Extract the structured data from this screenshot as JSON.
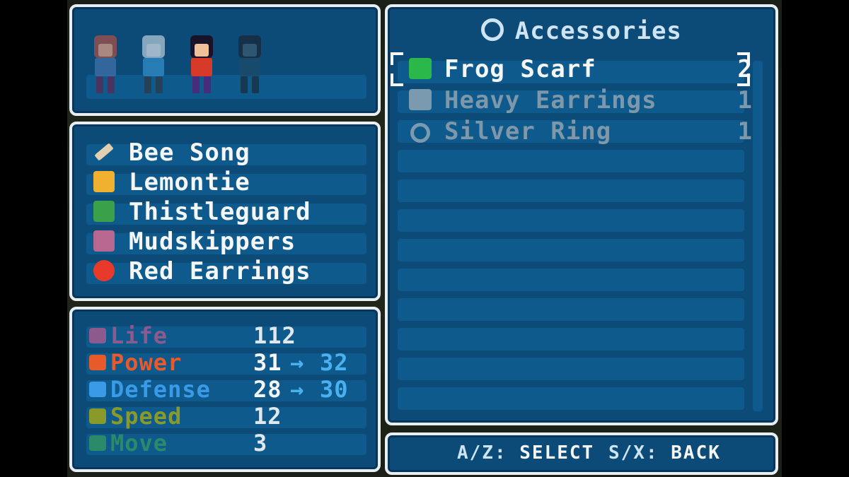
{
  "party": {
    "members": [
      {
        "name": "member-1",
        "hair": "#a0504a",
        "shirt": "#3f6fa8",
        "legs": "#5a2a55",
        "skin": "#d49a84",
        "dim": true
      },
      {
        "name": "member-2",
        "hair": "#a8c0d0",
        "shirt": "#2f8ac8",
        "legs": "#2a3a4a",
        "skin": "#c8d8e0",
        "dim": true
      },
      {
        "name": "member-3",
        "hair": "#18122a",
        "shirt": "#d83a2a",
        "legs": "#4a2a7a",
        "skin": "#f0c098",
        "dim": false
      },
      {
        "name": "member-4",
        "hair": "#1a2a3a",
        "shirt": "#1c4a6a",
        "legs": "#183040",
        "skin": "#3a5a70",
        "dim": true
      }
    ]
  },
  "equipment": {
    "items": [
      {
        "label": "Bee Song",
        "icon": "flute-icon"
      },
      {
        "label": "Lemontie",
        "icon": "tie-icon"
      },
      {
        "label": "Thistleguard",
        "icon": "armor-icon"
      },
      {
        "label": "Mudskippers",
        "icon": "boot-icon"
      },
      {
        "label": "Red Earrings",
        "icon": "earrings-icon"
      }
    ]
  },
  "stats": {
    "rows": [
      {
        "name": "Life",
        "value": "112",
        "arrow": "",
        "new_value": "",
        "color": "#8c5a8c",
        "icon": "heart-icon"
      },
      {
        "name": "Power",
        "value": "31",
        "arrow": "→",
        "new_value": "32",
        "color": "#e85a2a",
        "icon": "fist-icon"
      },
      {
        "name": "Defense",
        "value": "28",
        "arrow": "→",
        "new_value": "30",
        "color": "#3a9ae8",
        "icon": "shield-icon"
      },
      {
        "name": "Speed",
        "value": "12",
        "arrow": "",
        "new_value": "",
        "color": "#8a9a2a",
        "icon": "chevron-icon"
      },
      {
        "name": "Move",
        "value": "3",
        "arrow": "",
        "new_value": "",
        "color": "#2a8a6a",
        "icon": "boot-icon"
      }
    ],
    "highlight_color": "#4ab0f0"
  },
  "accessories": {
    "title": "Accessories",
    "title_icon": "ring-icon",
    "items": [
      {
        "label": "Frog Scarf",
        "qty": "2",
        "icon": "frog-scarf-icon",
        "selected": true
      },
      {
        "label": "Heavy Earrings",
        "qty": "1",
        "icon": "earrings-icon",
        "selected": false
      },
      {
        "label": "Silver Ring",
        "qty": "1",
        "icon": "ring-icon",
        "selected": false
      }
    ]
  },
  "footer": {
    "select_key": "A/Z:",
    "select_label": "SELECT",
    "back_key": "S/X:",
    "back_label": "BACK"
  }
}
